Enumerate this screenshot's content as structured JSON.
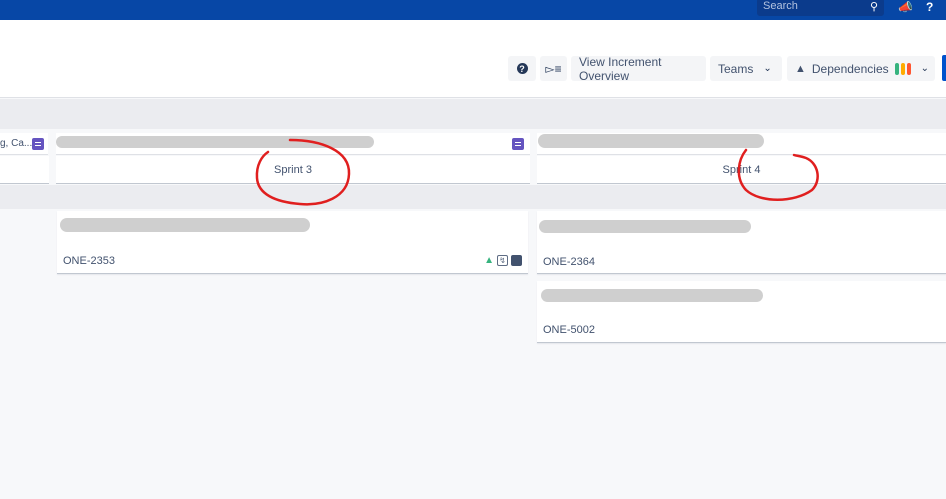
{
  "topbar": {
    "search_placeholder": "Search"
  },
  "toolbar": {
    "help_glyph": "?",
    "view_increment_label": "View Increment Overview",
    "teams_label": "Teams",
    "dependencies_label": "Dependencies",
    "dependency_colors": [
      "#36b37e",
      "#ffab00",
      "#ff5630"
    ]
  },
  "columns": {
    "left_partial_title": "g, Ca...",
    "sprint3_label": "Sprint 3",
    "sprint4_label": "Sprint 4"
  },
  "cards": [
    {
      "key": "ONE-2353"
    },
    {
      "key": "ONE-2364"
    },
    {
      "key": "ONE-5002"
    }
  ],
  "colors": {
    "topbar": "#0747a6",
    "accent": "#0052cc",
    "annotation": "#e01f1f"
  }
}
